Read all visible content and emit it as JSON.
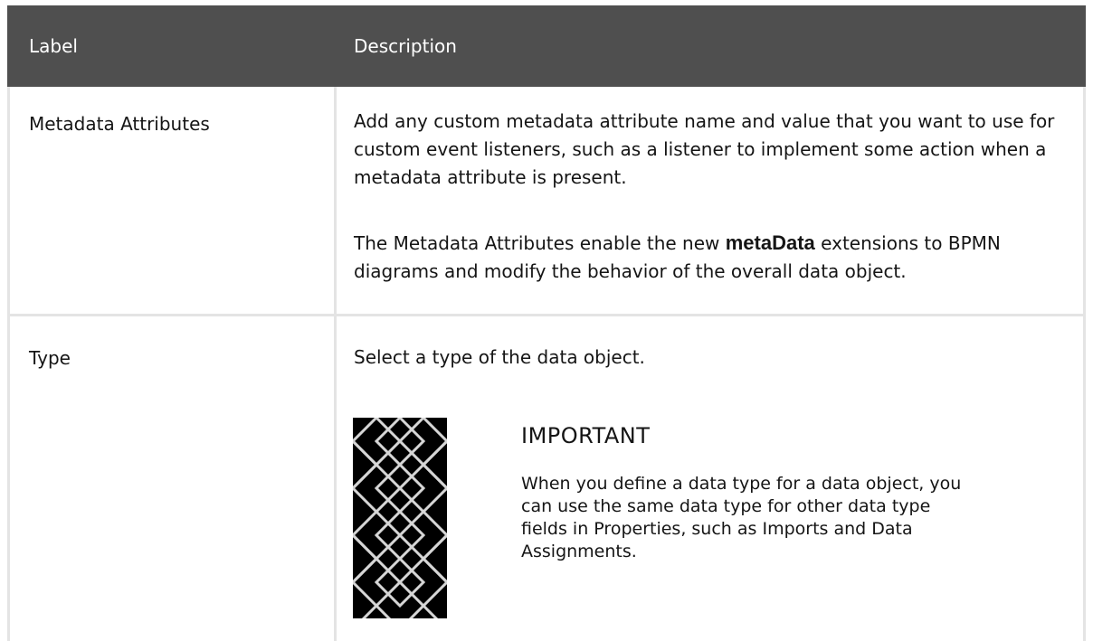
{
  "table": {
    "header": {
      "label": "Label",
      "description": "Description"
    },
    "rows": [
      {
        "label": "Metadata Attributes",
        "paragraph1": "Add any custom metadata attribute name and value that you want to use for custom event listeners, such as a listener to implement some action when a metadata attribute is present.",
        "p2_before": "The ",
        "p2_term": "Metadata Attributes",
        "p2_mid": " enable the new ",
        "p2_code": "metaData",
        "p2_after": " extensions to BPMN diagrams and modify the behavior of the overall data object."
      },
      {
        "label": "Type",
        "paragraph1": "Select a type of the data object.",
        "admonition": {
          "icon": "important-icon",
          "heading": "IMPORTANT",
          "body_1": "When you define a data type for a data object, you can use the same data type for other data type fields in ",
          "term_properties": "Properties",
          "body_2": ", such as ",
          "term_imports": "Imports",
          "body_3": " and ",
          "term_assignments": "Data Assignments",
          "body_4": "."
        }
      }
    ]
  },
  "colors": {
    "header_bg": "#4f4f4f",
    "border": "#e4e4e4",
    "text": "#151515"
  }
}
